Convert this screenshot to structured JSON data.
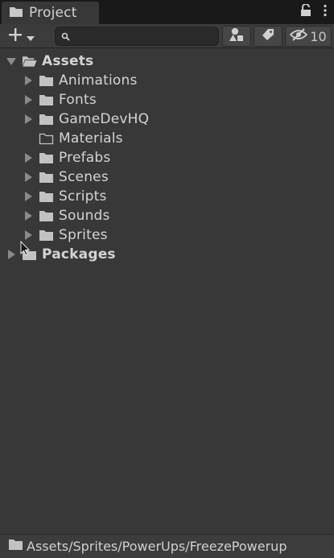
{
  "window": {
    "tab_title": "Project",
    "hidden_count": "10"
  },
  "search": {
    "value": "",
    "placeholder": ""
  },
  "tree": {
    "assets_label": "Assets",
    "children": [
      {
        "label": "Animations",
        "has_children": true
      },
      {
        "label": "Fonts",
        "has_children": true
      },
      {
        "label": "GameDevHQ",
        "has_children": true
      },
      {
        "label": "Materials",
        "has_children": false
      },
      {
        "label": "Prefabs",
        "has_children": true
      },
      {
        "label": "Scenes",
        "has_children": true
      },
      {
        "label": "Scripts",
        "has_children": true
      },
      {
        "label": "Sounds",
        "has_children": true
      },
      {
        "label": "Sprites",
        "has_children": true
      }
    ],
    "packages_label": "Packages"
  },
  "status": {
    "path": "Assets/Sprites/PowerUps/FreezePowerup"
  },
  "icons": {
    "tab": "folder-icon",
    "lock": "lock-icon",
    "menu": "kebab-menu-icon",
    "create": "plus-icon",
    "search": "search-icon",
    "type_filter": "shapes-icon",
    "label_filter": "tag-icon",
    "hidden": "eye-slash-icon"
  },
  "colors": {
    "background": "#383838",
    "tab_bar": "#191919",
    "toolbar": "#3c3c3c",
    "text": "#d4d4d4",
    "folder": "#c2c2c2"
  }
}
